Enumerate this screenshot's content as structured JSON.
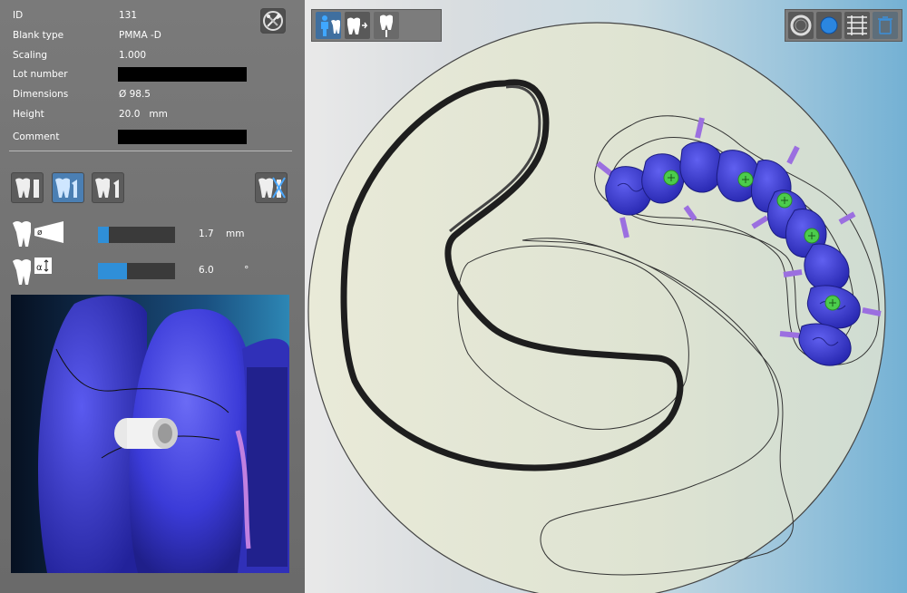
{
  "properties": [
    {
      "label": "ID",
      "value": "131"
    },
    {
      "label": "Blank type",
      "value": "PMMA -D"
    },
    {
      "label": "Scaling",
      "value": "1.000"
    },
    {
      "label": "Lot number",
      "value": ""
    },
    {
      "label": "Dimensions",
      "value": "Ø 98.5"
    },
    {
      "label": "Height",
      "value": "20.0   mm"
    },
    {
      "label": "Comment",
      "value": ""
    }
  ],
  "sliders": {
    "diameter": {
      "value": "1.7    mm",
      "fill_fraction": 0.14
    },
    "angle": {
      "value": "6.0          °",
      "fill_fraction": 0.38
    }
  },
  "colors": {
    "accent": "#2f8fd8",
    "tooth_blue": "#3b3bdc",
    "sprue_purple": "#a070e0",
    "marker_green": "#4cd04c",
    "blank_fill": "#e6e8d2"
  },
  "icons": {
    "settings": "tools-gear-icon",
    "tooth_modes": [
      "tooth-left-icon",
      "tooth-center-icon",
      "tooth-right-icon"
    ],
    "tooth_delete": "tooth-delete-icon",
    "diameter": "tooth-diameter-icon",
    "angle": "tooth-angle-icon",
    "view_tools": [
      "person-tooth-icon",
      "tooth-arrow-icon",
      "tooth-pin-icon"
    ],
    "render_tools": [
      "ring-icon",
      "sphere-icon",
      "grid-icon",
      "trash-icon"
    ]
  }
}
